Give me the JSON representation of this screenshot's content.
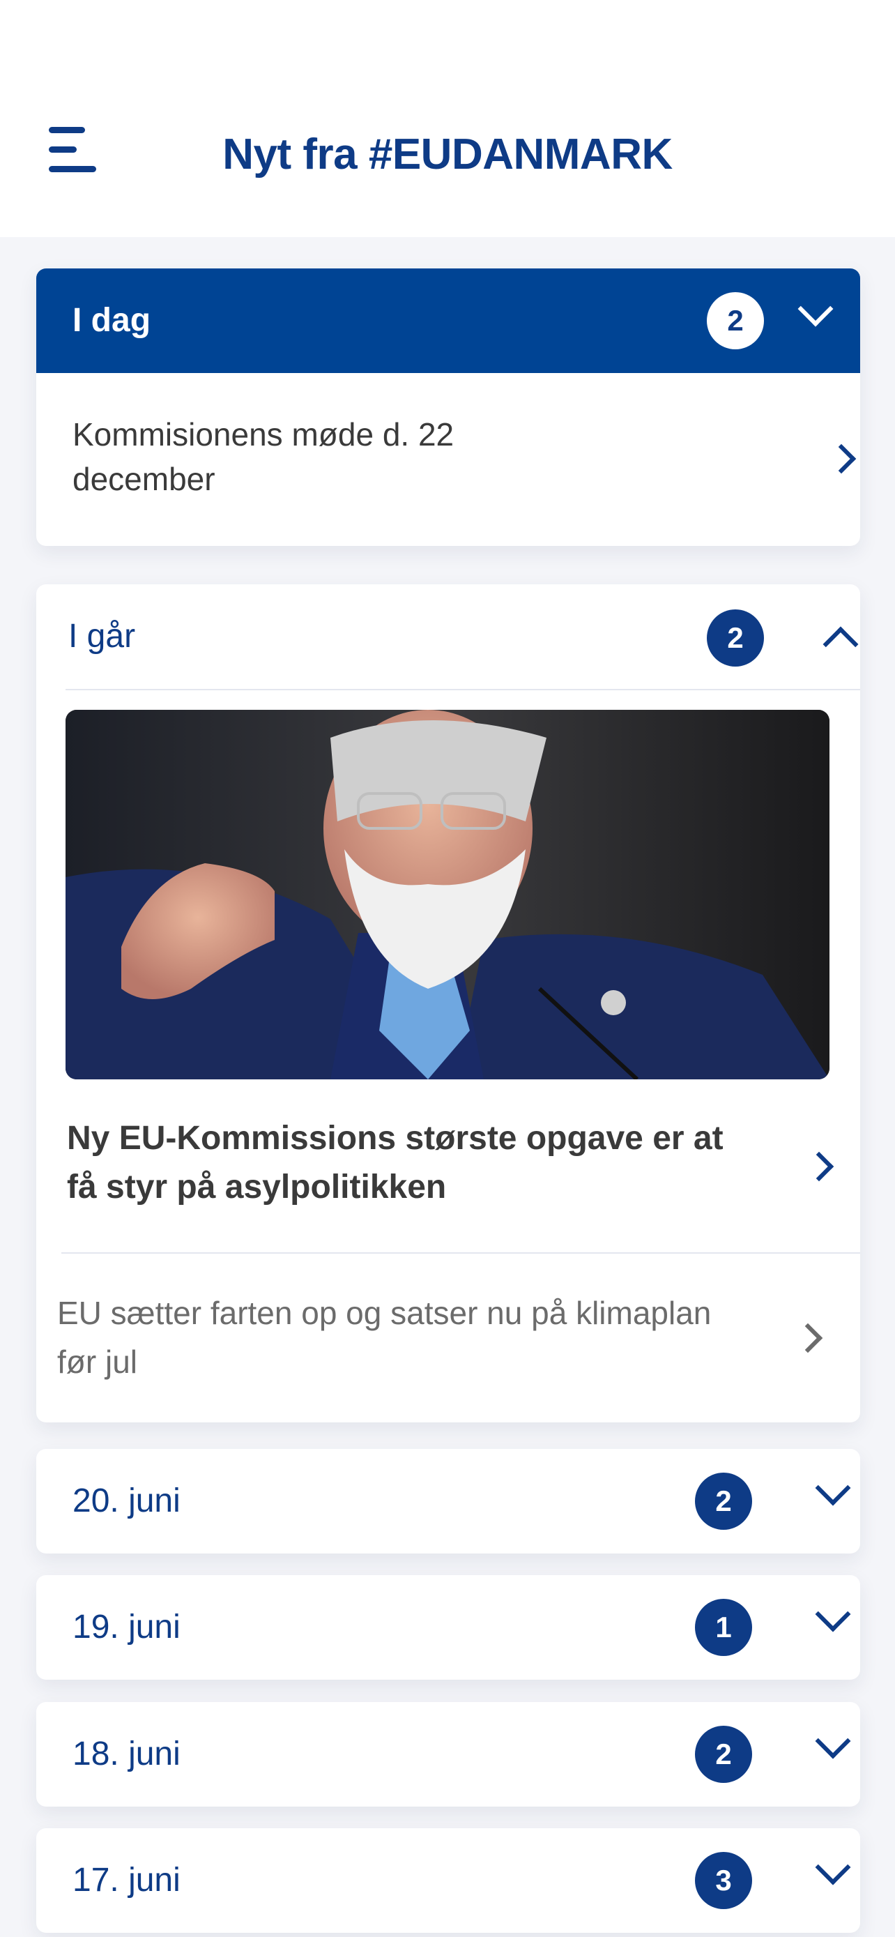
{
  "header": {
    "title": "Nyt fra #EUDANMARK",
    "menu_icon": "hamburger-menu-icon"
  },
  "sections": {
    "today": {
      "label": "I dag",
      "count": "2",
      "expanded": true,
      "items": [
        {
          "title": "Kommisionens møde d. 22 december"
        }
      ]
    },
    "yesterday": {
      "label": "I går",
      "count": "2",
      "expanded": true,
      "items": [
        {
          "title": "Ny EU-Kommissions største opgave er at få styr på asylpolitikken",
          "has_image": true
        },
        {
          "title": "EU sætter farten op og satser nu på klimaplan før jul"
        }
      ]
    },
    "jun20": {
      "label": "20. juni",
      "count": "2"
    },
    "jun19": {
      "label": "19. juni",
      "count": "1"
    },
    "jun18": {
      "label": "18. juni",
      "count": "2"
    },
    "jun17": {
      "label": "17. juni",
      "count": "3"
    }
  },
  "colors": {
    "primary": "#004494",
    "title_blue": "#0e3b86",
    "background": "#f4f5f9",
    "card": "#ffffff",
    "muted_text": "#6b6b6b"
  }
}
